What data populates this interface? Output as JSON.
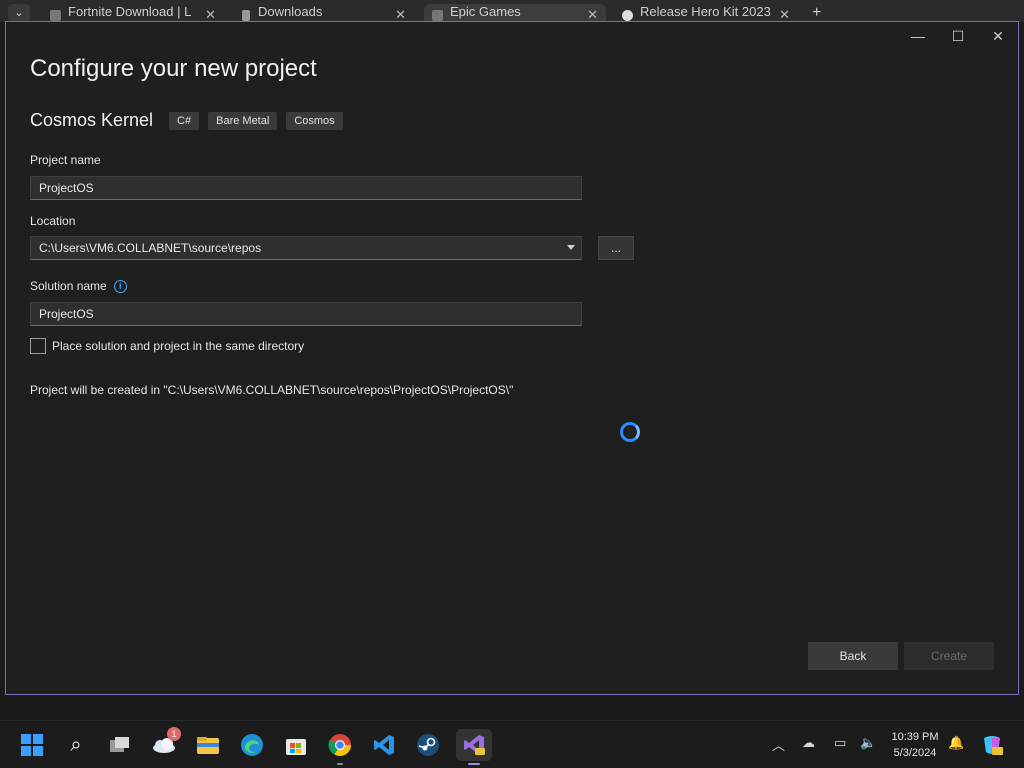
{
  "browser_tabs": [
    {
      "label": "Fortnite Download | L"
    },
    {
      "label": "Downloads"
    },
    {
      "label": "Epic Games"
    },
    {
      "label": "Release Hero Kit 2023"
    }
  ],
  "dialog": {
    "title": "Configure your new project",
    "template_name": "Cosmos Kernel",
    "tags": [
      "C#",
      "Bare Metal",
      "Cosmos"
    ],
    "project_name_label": "Project name",
    "project_name_value": "ProjectOS",
    "location_label": "Location",
    "location_value": "C:\\Users\\VM6.COLLABNET\\source\\repos",
    "browse_label": "...",
    "solution_name_label": "Solution name",
    "solution_name_value": "ProjectOS",
    "same_dir_label": "Place solution and project in the same directory",
    "same_dir_checked": false,
    "path_note": "Project will be created in \"C:\\Users\\VM6.COLLABNET\\source\\repos\\ProjectOS\\ProjectOS\\\"",
    "back_label": "Back",
    "create_label": "Create"
  },
  "taskbar": {
    "weather_badge": "1",
    "time": "10:39 PM",
    "date": "5/3/2024"
  },
  "colors": {
    "accent_border": "#7a6ab8",
    "spinner": "#2a8cff",
    "info": "#4aa3ff"
  }
}
